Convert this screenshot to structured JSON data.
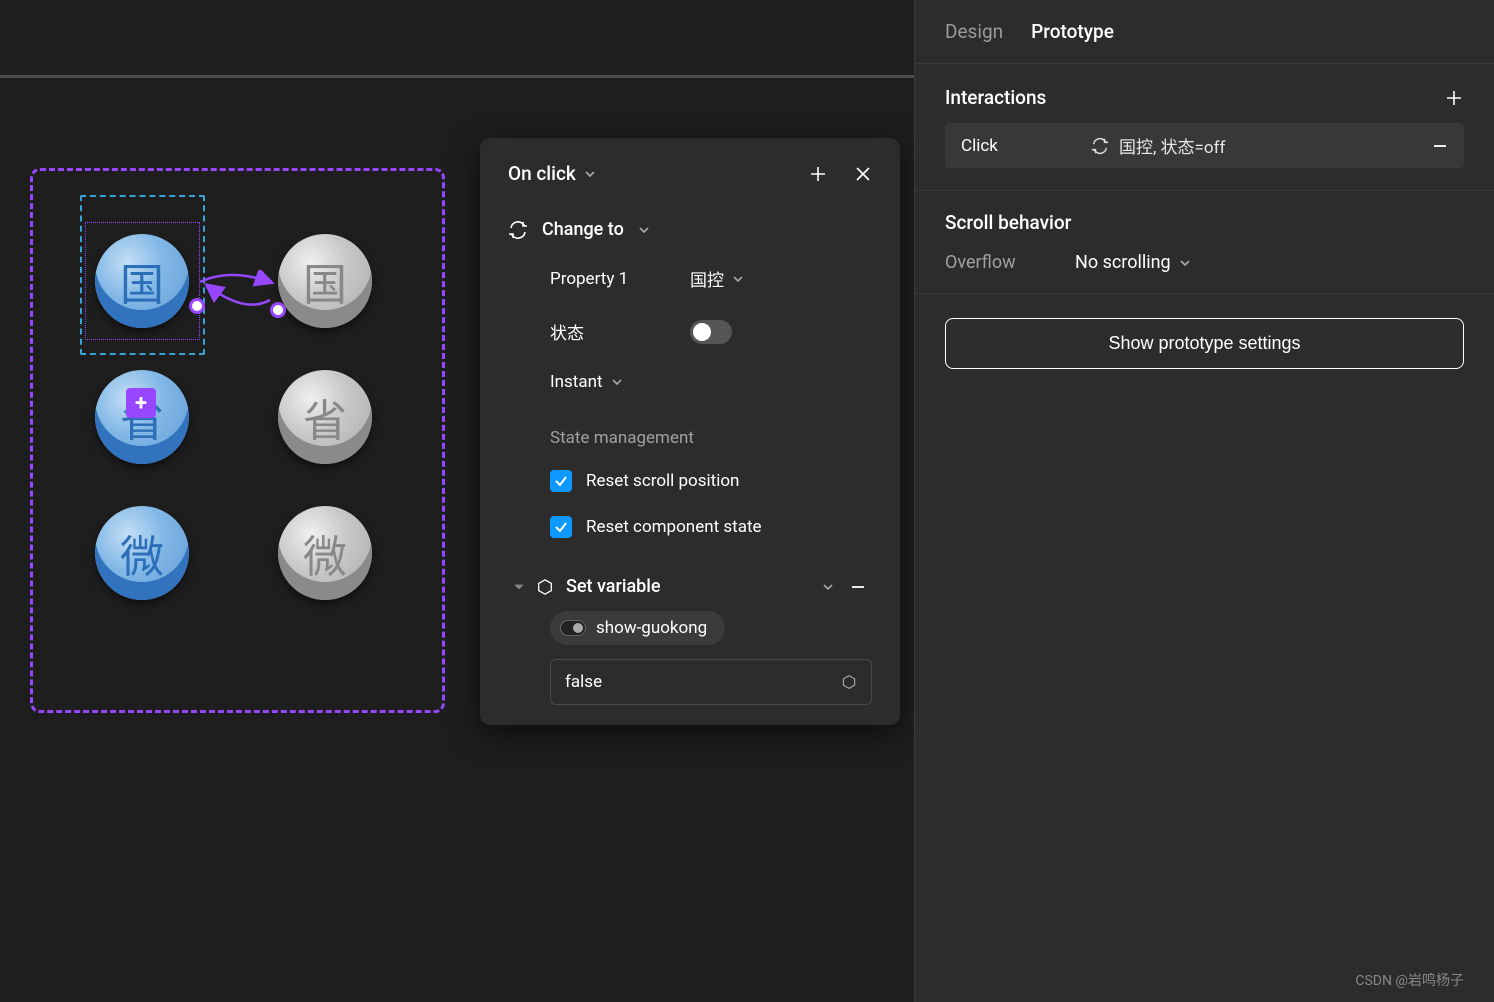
{
  "canvas": {
    "tokens": {
      "guo": "国",
      "sheng": "省",
      "wei": "微"
    }
  },
  "popup": {
    "trigger": "On click",
    "change_to": "Change to",
    "property1_label": "Property 1",
    "property1_value": "国控",
    "state_label": "状态",
    "animation": "Instant",
    "state_management": "State management",
    "reset_scroll": "Reset scroll position",
    "reset_component": "Reset component state",
    "set_variable": "Set variable",
    "variable_name": "show-guokong",
    "variable_value": "false"
  },
  "panel": {
    "tabs": {
      "design": "Design",
      "prototype": "Prototype"
    },
    "interactions_title": "Interactions",
    "interaction": {
      "trigger": "Click",
      "action": "国控, 状态=off"
    },
    "scroll_behavior_title": "Scroll behavior",
    "overflow_label": "Overflow",
    "overflow_value": "No scrolling",
    "show_prototype": "Show prototype settings"
  },
  "watermark": "CSDN @岩鸣杨子"
}
